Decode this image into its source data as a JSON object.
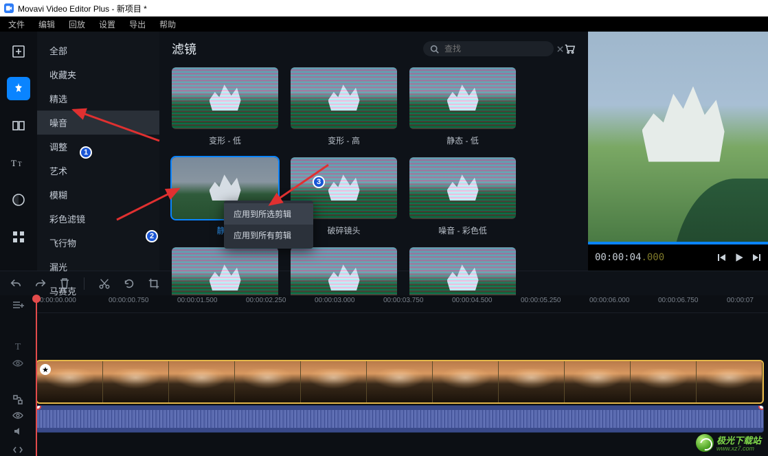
{
  "titlebar": {
    "title": "Movavi Video Editor Plus - 新项目 *"
  },
  "menubar": [
    "文件",
    "编辑",
    "回放",
    "设置",
    "导出",
    "帮助"
  ],
  "sidebar": {
    "items": [
      "全部",
      "收藏夹",
      "精选",
      "噪音",
      "调整",
      "艺术",
      "模糊",
      "彩色滤镜",
      "飞行物",
      "漏光",
      "马赛克"
    ],
    "selected_index": 3
  },
  "content": {
    "title": "滤镜",
    "search_placeholder": "查找",
    "tiles": [
      {
        "label": "变形 - 低"
      },
      {
        "label": "变形 - 高"
      },
      {
        "label": "静态 - 低"
      },
      {
        "label": "静态",
        "selected": true
      },
      {
        "label": "破碎镜头"
      },
      {
        "label": "噪音 - 彩色低"
      }
    ]
  },
  "context_menu": {
    "items": [
      "应用到所选剪辑",
      "应用到所有剪辑"
    ]
  },
  "preview": {
    "timecode_main": "00:00:04",
    "timecode_ms": ".000"
  },
  "ruler": {
    "ticks": [
      "0:00:00.000",
      "00:00:00.750",
      "00:00:01.500",
      "00:00:02.250",
      "00:00:03.000",
      "00:00:03.750",
      "00:00:04.500",
      "00:00:05.250",
      "00:00:06.000",
      "00:00:06.750",
      "00:00:07"
    ]
  },
  "badges": {
    "b1": "1",
    "b2": "2",
    "b3": "3"
  },
  "watermark": {
    "brand": "极光下载站",
    "url": "www.xz7.com"
  }
}
